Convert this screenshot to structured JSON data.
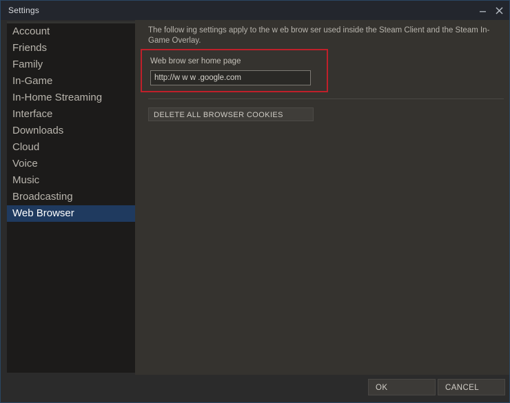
{
  "window": {
    "title": "Settings",
    "controls": [
      {
        "name": "minimize",
        "glyph": "minimize-icon"
      },
      {
        "name": "close",
        "glyph": "close-icon"
      }
    ]
  },
  "sidebar": {
    "items": [
      {
        "label": "Account",
        "selected": false
      },
      {
        "label": "Friends",
        "selected": false
      },
      {
        "label": "Family",
        "selected": false
      },
      {
        "label": "In-Game",
        "selected": false
      },
      {
        "label": "In-Home Streaming",
        "selected": false
      },
      {
        "label": "Interface",
        "selected": false
      },
      {
        "label": "Downloads",
        "selected": false
      },
      {
        "label": "Cloud",
        "selected": false
      },
      {
        "label": "Voice",
        "selected": false
      },
      {
        "label": "Music",
        "selected": false
      },
      {
        "label": "Broadcasting",
        "selected": false
      },
      {
        "label": "Web Browser",
        "selected": true
      }
    ]
  },
  "panel": {
    "description": "The follow ing settings apply to the w eb brow ser used inside the Steam Client and the Steam In-Game Overlay.",
    "home_page_label": "Web brow ser home page",
    "home_page_value": "http://w w w .google.com",
    "home_page_placeholder": "http://",
    "delete_cookies_label": "DELETE ALL BROWSER COOKIES"
  },
  "footer": {
    "ok_label": "OK",
    "cancel_label": "CANCEL"
  },
  "colors": {
    "titlebar": "#23262d",
    "sidebar": "#1c1b1a",
    "panel": "#35332f",
    "selected_item": "#1f3a5f",
    "annotation_border": "#c0202a",
    "window_border": "#2a4763"
  }
}
